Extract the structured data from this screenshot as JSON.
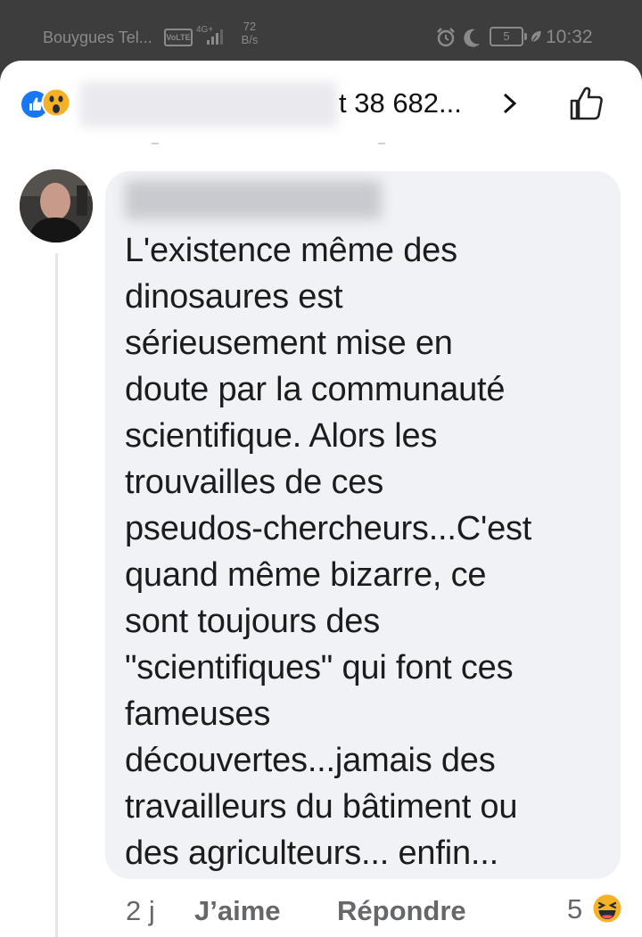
{
  "status_bar": {
    "carrier": "Bouygues Tel...",
    "volte": "VoLTE",
    "network_type": "4G+",
    "net_speed_value": "72",
    "net_speed_unit": "B/s",
    "battery_level": "5",
    "time": "10:32"
  },
  "header": {
    "reactors_text": "t 38 682...",
    "reactions": [
      "like",
      "wow"
    ]
  },
  "comment": {
    "text_lines": [
      "L'existence même des",
      "dinosaures est",
      "sérieusement mise en",
      "doute par la communauté",
      "scientifique.  Alors les",
      "trouvailles de ces",
      "pseudos-chercheurs...C'est",
      "quand même bizarre, ce",
      "sont toujours des",
      "\"scientifiques\" qui font ces",
      "fameuses",
      "découvertes...jamais des",
      "travailleurs du bâtiment ou",
      "des agriculteurs... enfin..."
    ]
  },
  "footer": {
    "time_ago": "2 j",
    "like_label": "J’aime",
    "reply_label": "Répondre",
    "reaction_count": "5",
    "reaction_type": "haha"
  },
  "colors": {
    "facebook_blue": "#1877f2",
    "bubble_bg": "#f0f2f5",
    "meta_text": "#65676b",
    "status_bar_bg": "#3d3d3d"
  }
}
